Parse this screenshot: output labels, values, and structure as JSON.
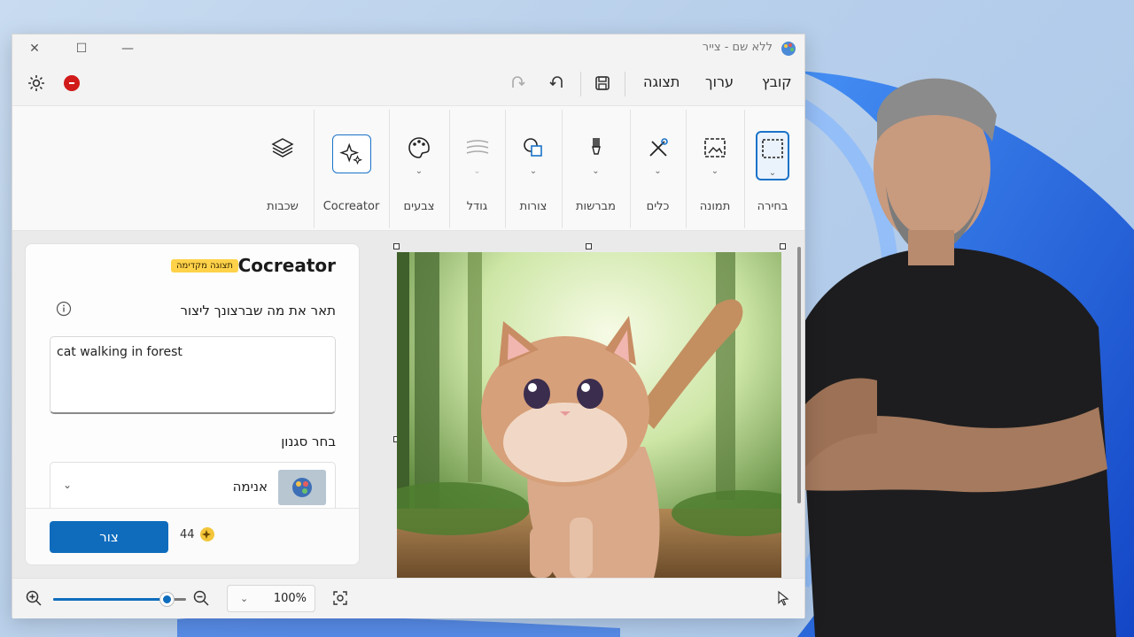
{
  "window": {
    "title": "ללא שם - צייר",
    "controls": {
      "close": "✕",
      "maximize": "☐",
      "minimize": "—"
    }
  },
  "menubar": {
    "items": [
      "קובץ",
      "ערוך",
      "תצוגה"
    ]
  },
  "ribbon": {
    "groups": [
      {
        "label": "בחירה",
        "icon": "selection-icon"
      },
      {
        "label": "תמונה",
        "icon": "image-icon"
      },
      {
        "label": "כלים",
        "icon": "tools-icon"
      },
      {
        "label": "מברשות",
        "icon": "brush-icon"
      },
      {
        "label": "צורות",
        "icon": "shapes-icon"
      },
      {
        "label": "גודל",
        "icon": "size-icon"
      },
      {
        "label": "צבעים",
        "icon": "palette-icon"
      },
      {
        "label": "Cocreator",
        "icon": "cocreator-sparkle-icon"
      },
      {
        "label": "שכבות",
        "icon": "layers-icon"
      }
    ]
  },
  "cocreator_panel": {
    "title": "Cocreator",
    "badge": "תצוגה מקדימה",
    "prompt_label": "תאר את מה שברצונך ליצור",
    "prompt_value": "cat walking in forest",
    "style_label": "בחר סגנון",
    "style_value": "אנימה",
    "create_button": "צור",
    "credits": "44"
  },
  "statusbar": {
    "zoom": "100%",
    "zoom_slider_level": 0.85
  },
  "colors": {
    "accent": "#0f6cbd",
    "badge": "#ffd24a",
    "record": "#d11a1a"
  }
}
